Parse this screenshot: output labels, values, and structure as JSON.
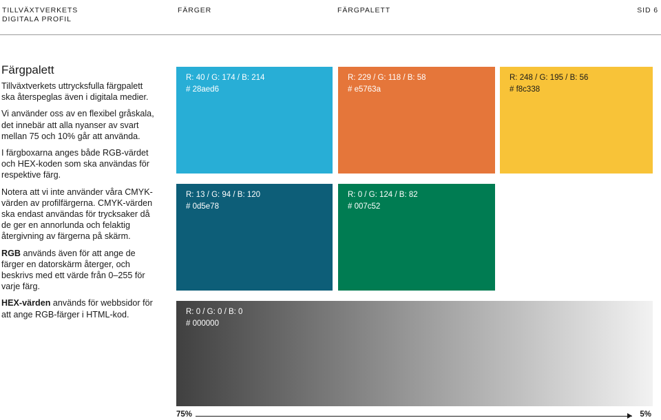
{
  "header": {
    "org_line1": "TILLVÄXTVERKETS",
    "org_line2": "DIGITALA PROFIL",
    "section": "FÄRGER",
    "subsection": "FÄRGPALETT",
    "page": "SID 6"
  },
  "intro": {
    "title": "Färgpalett",
    "p1": "Tillväxtverkets uttrycksfulla färgpalett ska återspeglas även i digitala medier.",
    "p2": "Vi använder oss av en flexibel gråskala, det innebär att alla nyanser av svart mellan 75 och 10% går att använda.",
    "p3": "I färgboxarna anges både RGB-värdet och HEX-koden som ska användas för respektive färg.",
    "p4": "Notera att vi inte använder våra CMYK-värden av profilfärgerna. CMYK-värden ska endast användas för trycksaker då de ger en annorlunda och felaktig återgivning av färgerna på skärm.",
    "p5_bold": "RGB",
    "p5_rest": " används även för att ange de färger en datorskärm återger, och beskrivs med ett värde från 0–255 för varje färg.",
    "p6_bold": "HEX-värden",
    "p6_rest": " används för webbsidor för att ange RGB-färger i HTML-kod."
  },
  "swatches": {
    "blue": {
      "rgb": "R: 40 / G: 174 / B: 214",
      "hex": "# 28aed6",
      "color": "#28aed6"
    },
    "orange": {
      "rgb": "R: 229 / G: 118 / B: 58",
      "hex": "# e5763a",
      "color": "#e5763a"
    },
    "yellow": {
      "rgb": "R: 248 / G: 195 / B: 56",
      "hex": "# f8c338",
      "color": "#f8c338"
    },
    "teal": {
      "rgb": "R: 13 / G: 94 / B: 120",
      "hex": "# 0d5e78",
      "color": "#0d5e78"
    },
    "green": {
      "rgb": "R: 0 / G: 124 / B: 82",
      "hex": "# 007c52",
      "color": "#007c52"
    },
    "black": {
      "rgb": "R: 0 / G: 0 / B: 0",
      "hex": "# 000000",
      "color": "#000000"
    }
  },
  "grayscale": {
    "from_label": "75%",
    "to_label": "5%",
    "from_shade": 0.75,
    "to_shade": 0.05
  }
}
